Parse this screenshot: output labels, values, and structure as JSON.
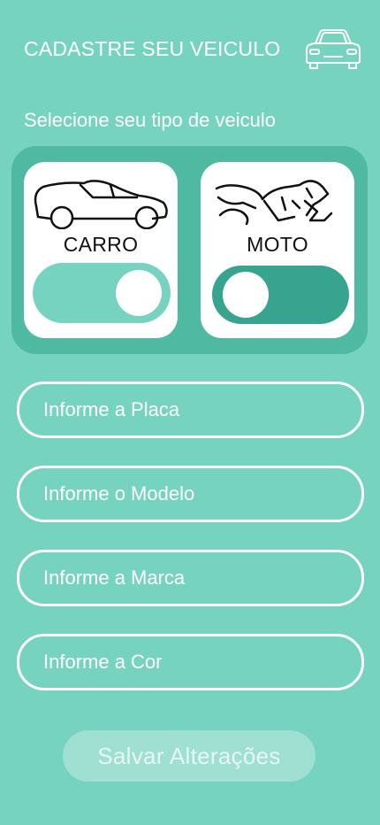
{
  "header": {
    "title": "CADASTRE SEU VEICULO",
    "icon": "car-icon"
  },
  "vehicle_selector": {
    "prompt": "Selecione seu tipo de veiculo",
    "options": [
      {
        "label": "CARRO",
        "selected": true,
        "icon": "car-silhouette-icon"
      },
      {
        "label": "MOTO",
        "selected": false,
        "icon": "motorcycle-silhouette-icon"
      }
    ]
  },
  "form": {
    "placa_placeholder": "Informe a Placa",
    "modelo_placeholder": "Informe o Modelo",
    "marca_placeholder": "Informe a Marca",
    "cor_placeholder": "Informe a Cor",
    "placa_value": "",
    "modelo_value": "",
    "marca_value": "",
    "cor_value": ""
  },
  "actions": {
    "save_label": "Salvar Alterações"
  },
  "colors": {
    "background": "#76d3c0",
    "panel": "#4fb9a2",
    "toggle_off": "#36a48e",
    "white": "#ffffff"
  }
}
